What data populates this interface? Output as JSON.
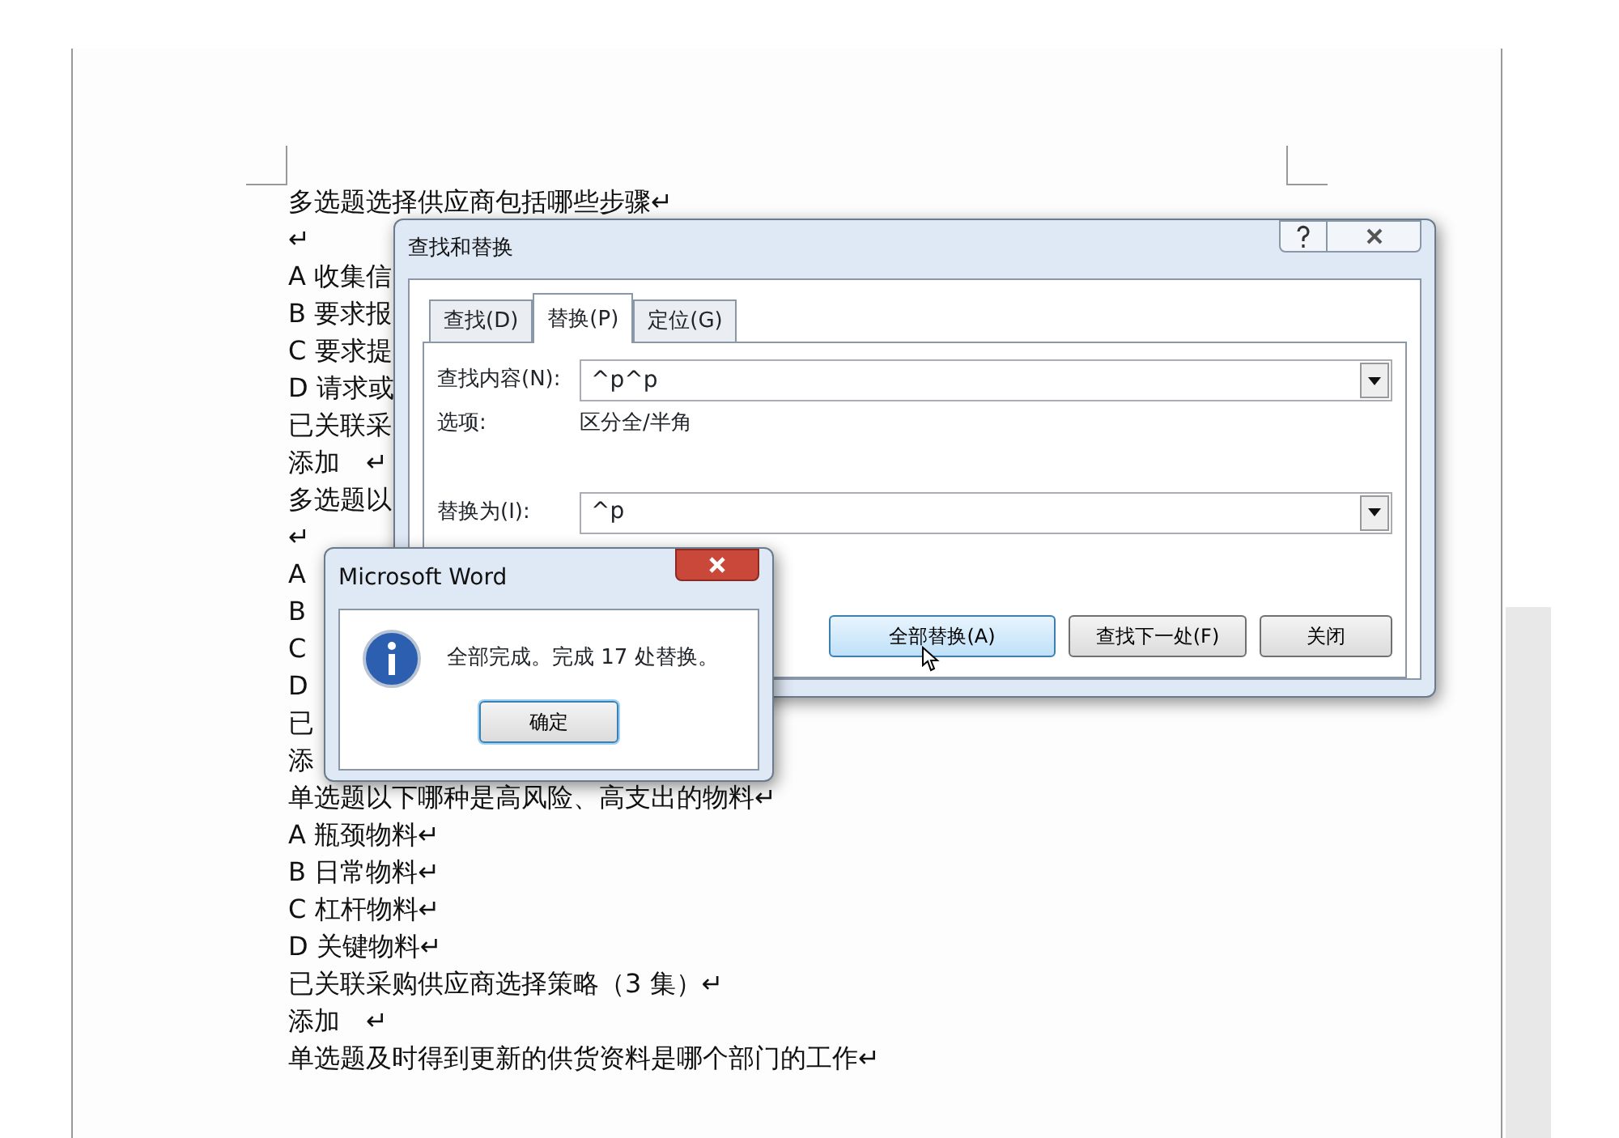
{
  "document": {
    "lines": [
      "多选题选择供应商包括哪些步骤↵",
      "↵",
      "A 收集信",
      "B 要求报",
      "C 要求提",
      "D 请求或",
      "已关联采",
      "添加　↵",
      "多选题以",
      "↵",
      "A",
      "B",
      "C",
      "D",
      "已",
      "添",
      "单选题以下哪种是高风险、高支出的物料↵",
      "A 瓶颈物料↵",
      "B 日常物料↵",
      "C 杠杆物料↵",
      "D 关键物料↵",
      "已关联采购供应商选择策略（3 集）↵",
      "添加　↵",
      "单选题及时得到更新的供货资料是哪个部门的工作↵"
    ]
  },
  "find_replace_dialog": {
    "title": "查找和替换",
    "tabs": [
      {
        "label": "查找(D)",
        "selected": false
      },
      {
        "label": "替换(P)",
        "selected": true
      },
      {
        "label": "定位(G)",
        "selected": false
      }
    ],
    "find_what": {
      "label": "查找内容(N):",
      "value": "^p^p"
    },
    "options": {
      "label": "选项:",
      "value": "区分全/半角"
    },
    "replace_with": {
      "label": "替换为(I):",
      "value": "^p"
    },
    "buttons": [
      {
        "label": "全部替换(A)",
        "hovered": true
      },
      {
        "label": "查找下一处(F)",
        "hovered": false
      },
      {
        "label": "关闭",
        "hovered": false
      }
    ]
  },
  "message_box": {
    "title": "Microsoft Word",
    "message": "全部完成。完成 17 处替换。",
    "button": "确定"
  }
}
